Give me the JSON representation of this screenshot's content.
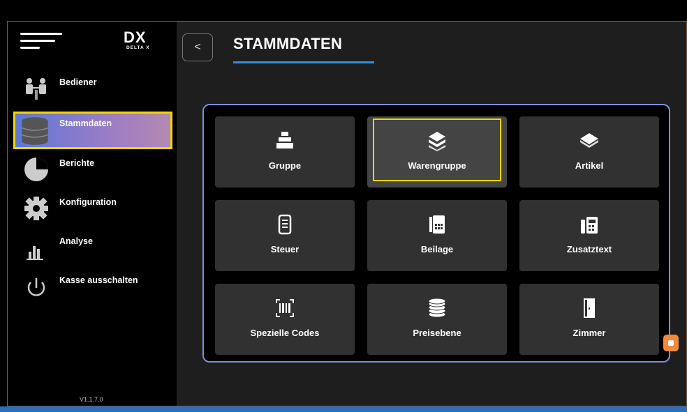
{
  "sidebar": {
    "logo": {
      "big": "DX",
      "small": "DELTA X"
    },
    "items": [
      {
        "label": "Bediener",
        "icon": "users-icon"
      },
      {
        "label": "Stammdaten",
        "icon": "database-icon"
      },
      {
        "label": "Berichte",
        "icon": "pie-chart-icon"
      },
      {
        "label": "Konfiguration",
        "icon": "gear-icon"
      },
      {
        "label": "Analyse",
        "icon": "bar-chart-icon"
      },
      {
        "label": "Kasse ausschalten",
        "icon": "power-icon"
      }
    ],
    "version": "V1.1.7.0"
  },
  "header": {
    "back_icon": "chevron-left-icon",
    "back_label": "<",
    "title": "STAMMDATEN"
  },
  "tiles": [
    {
      "label": "Gruppe",
      "icon": "stack-icon"
    },
    {
      "label": "Warengruppe",
      "icon": "layers-icon"
    },
    {
      "label": "Artikel",
      "icon": "box-icon"
    },
    {
      "label": "Steuer",
      "icon": "receipt-icon"
    },
    {
      "label": "Beilage",
      "icon": "calculator-icon"
    },
    {
      "label": "Zusatztext",
      "icon": "fax-icon"
    },
    {
      "label": "Spezielle Codes",
      "icon": "barcode-icon"
    },
    {
      "label": "Preisebene",
      "icon": "coins-icon"
    },
    {
      "label": "Zimmer",
      "icon": "door-icon"
    }
  ],
  "colors": {
    "accent": "#2e8fe6",
    "highlight": "#f2d600",
    "panel_border": "#7d8ed8",
    "badge": "#f08a3c"
  }
}
